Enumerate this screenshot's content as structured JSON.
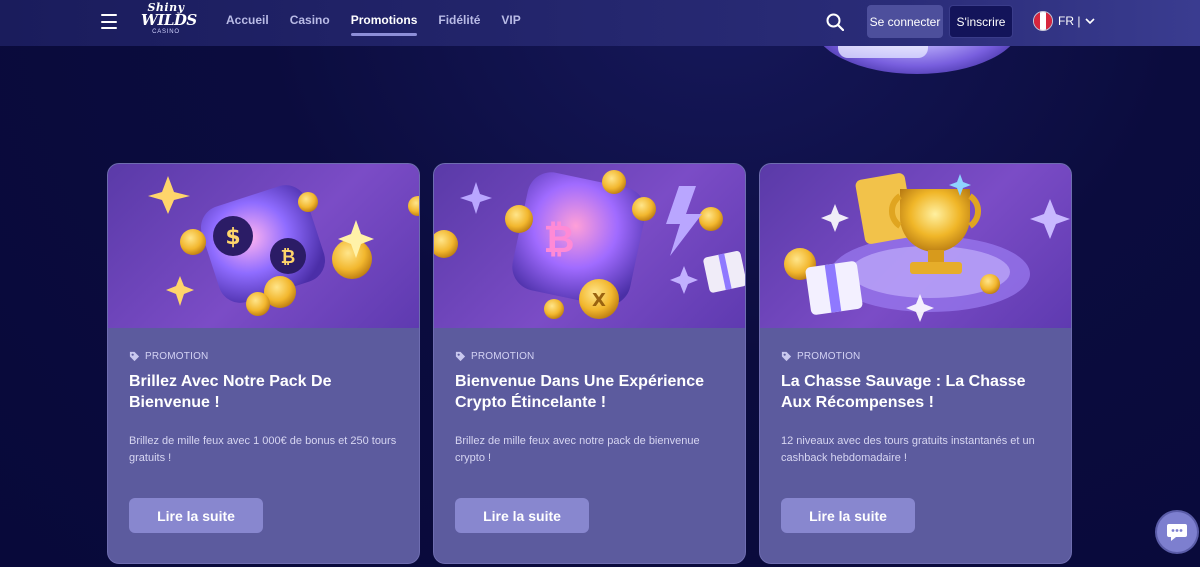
{
  "header": {
    "logo": {
      "line1": "Shiny",
      "line2": "WILDS",
      "line3": "CASINO"
    },
    "nav": [
      {
        "label": "Accueil",
        "active": false
      },
      {
        "label": "Casino",
        "active": false
      },
      {
        "label": "Promotions",
        "active": true
      },
      {
        "label": "Fidélité",
        "active": false
      },
      {
        "label": "VIP",
        "active": false
      }
    ],
    "login_label": "Se connecter",
    "signup_label": "S'inscrire",
    "language_label": "FR |",
    "icons": {
      "menu": "hamburger-menu-icon",
      "search": "search-icon",
      "lang_chevron": "chevron-down-icon"
    }
  },
  "cards": [
    {
      "tag": "PROMOTION",
      "title": "Brillez Avec Notre Pack De Bienvenue !",
      "description": "Brillez de mille feux avec 1 000€ de bonus et 250 tours gratuits !",
      "button": "Lire la suite",
      "image_theme": "dice-with-coins"
    },
    {
      "tag": "PROMOTION",
      "title": "Bienvenue Dans Une Expérience Crypto Étincelante !",
      "description": "Brillez de mille feux avec notre pack de bienvenue crypto !",
      "button": "Lire la suite",
      "image_theme": "crypto-cube-with-coins"
    },
    {
      "tag": "PROMOTION",
      "title": "La Chasse Sauvage : La Chasse Aux Récompenses !",
      "description": "12 niveaux avec des tours gratuits instantanés et un cashback hebdomadaire !",
      "button": "Lire la suite",
      "image_theme": "trophy-with-gifts"
    }
  ],
  "chat": {
    "icon": "chat-bubble-icon"
  },
  "colors": {
    "background": "#0b0c3e",
    "card": "#5c5b9e",
    "button": "#8887cf",
    "signup": "#13145a"
  }
}
